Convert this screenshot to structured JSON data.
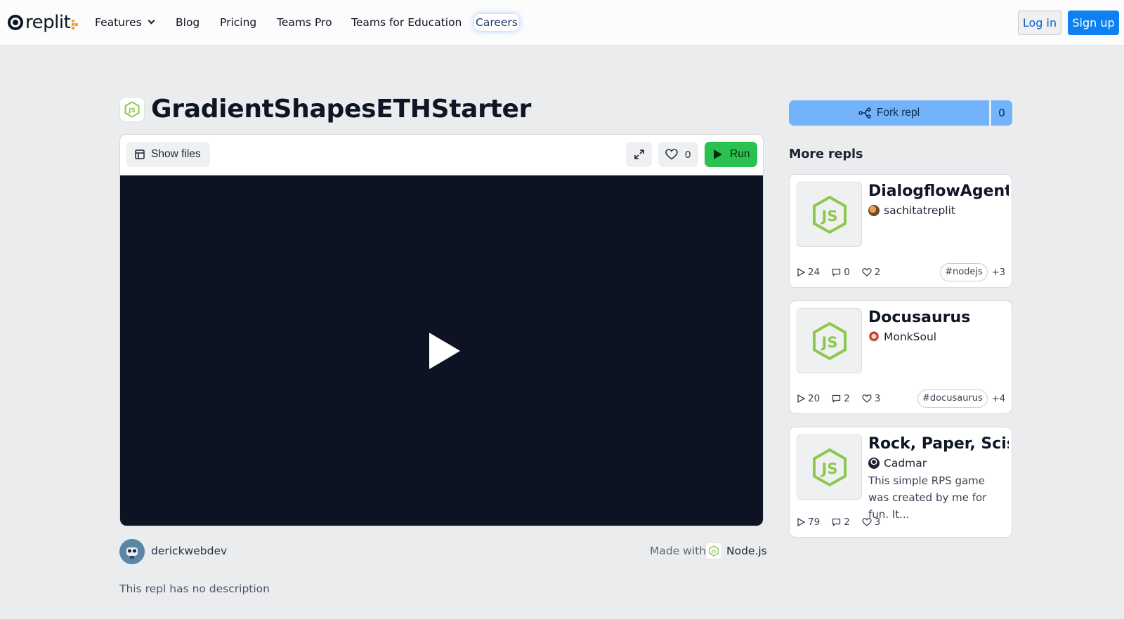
{
  "nav": {
    "logo_text": "replit",
    "items": [
      "Features",
      "Blog",
      "Pricing",
      "Teams Pro",
      "Teams for Education",
      "Careers"
    ],
    "login_label": "Log in",
    "signup_label": "Sign up"
  },
  "repl": {
    "title": "GradientShapesETHStarter",
    "show_files_label": "Show files",
    "likes": "0",
    "run_label": "Run",
    "author": "derickwebdev",
    "made_with_label": "Made with",
    "language": "Node.js",
    "description": "This repl has no description"
  },
  "sidebar": {
    "fork_label": "Fork repl",
    "fork_count": "0",
    "more_title": "More repls",
    "cards": [
      {
        "title": "DialogflowAgent...",
        "author": "sachitatreplit",
        "runs": "24",
        "comments": "0",
        "likes": "2",
        "tag": "#nodejs",
        "more_tags": "+3",
        "description": ""
      },
      {
        "title": "Docusaurus",
        "author": "MonkSoul",
        "runs": "20",
        "comments": "2",
        "likes": "3",
        "tag": "#docusaurus",
        "more_tags": "+4",
        "description": ""
      },
      {
        "title": "Rock, Paper, Scis...",
        "author": "Cadmar",
        "runs": "79",
        "comments": "2",
        "likes": "3",
        "tag": "",
        "more_tags": "",
        "description": "This simple RPS game was created by me for fun. It..."
      }
    ]
  },
  "colors": {
    "accent_blue": "#0d80f2",
    "run_green": "#2bc150",
    "fork_blue": "#72b3fb",
    "node_green": "#8cc84b",
    "stage_bg": "#0d1322"
  },
  "icons": {
    "logo": "replit-logo",
    "language": "nodejs-icon",
    "files": "files-icon",
    "expand": "expand-icon",
    "like": "heart-icon",
    "run": "play-icon",
    "fork": "fork-icon",
    "runs": "play-outline-icon",
    "comments": "comment-icon"
  }
}
